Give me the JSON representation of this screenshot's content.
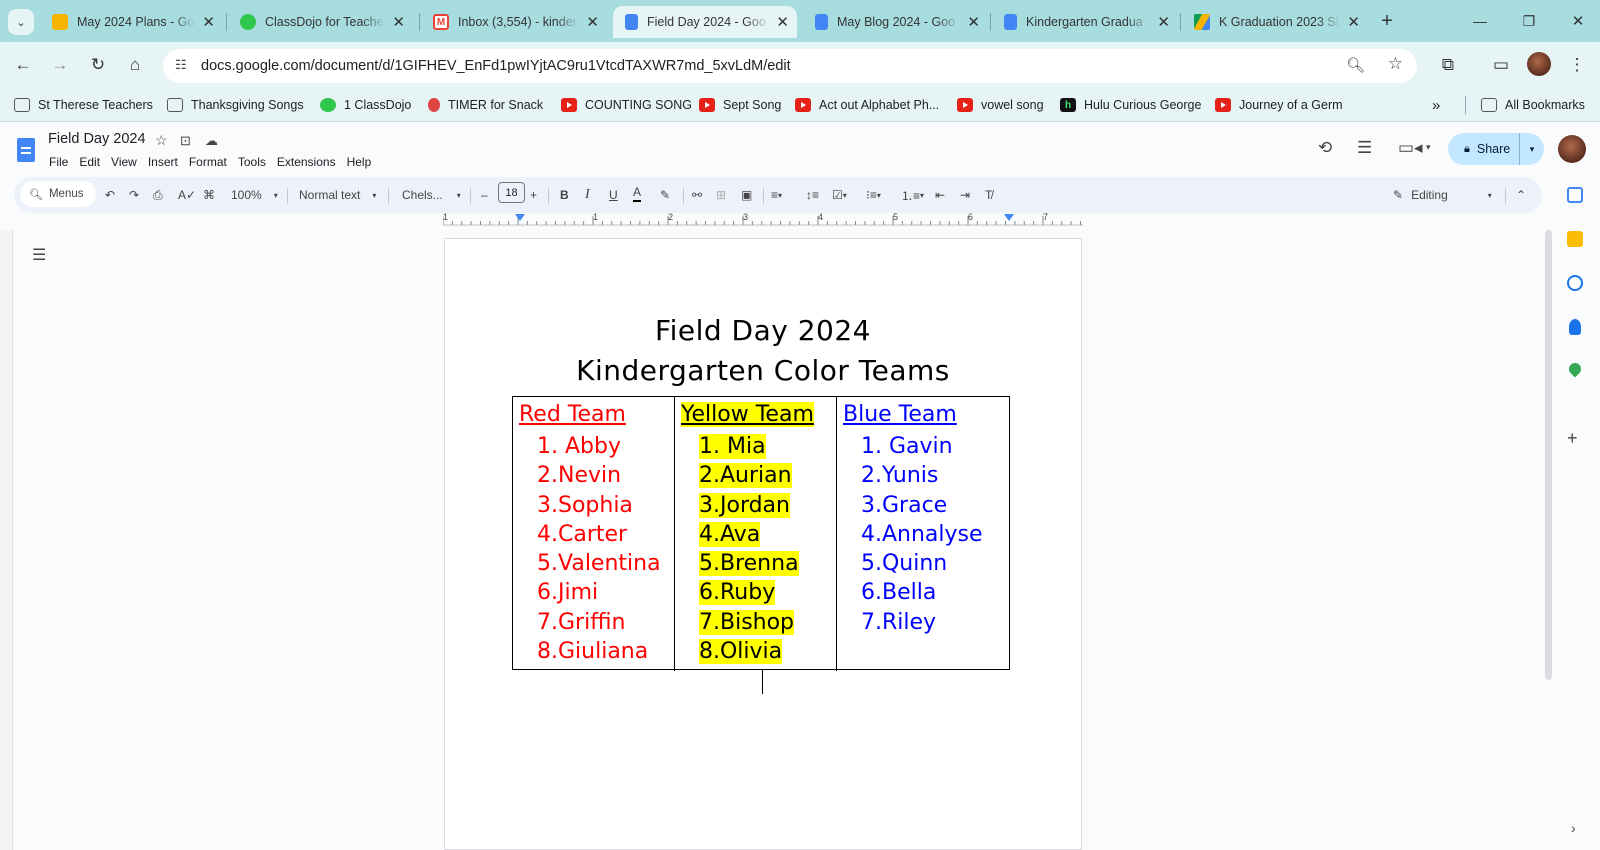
{
  "browser": {
    "tabs": [
      {
        "label": "May 2024 Plans - Go",
        "icon": "slides-icon",
        "color": "#f4b400"
      },
      {
        "label": "ClassDojo for Teache",
        "icon": "classdojo-icon",
        "color": "#2fc84d"
      },
      {
        "label": "Inbox (3,554) - kinder",
        "icon": "gmail-icon",
        "color": "#ea4335"
      },
      {
        "label": "Field Day 2024 - Goo",
        "icon": "docs-icon",
        "color": "#4285f4"
      },
      {
        "label": "May Blog 2024 - Goo",
        "icon": "docs-icon",
        "color": "#4285f4"
      },
      {
        "label": "Kindergarten Gradua",
        "icon": "docs-icon",
        "color": "#4285f4"
      },
      {
        "label": "K Graduation 2023 Sl",
        "icon": "drive-icon",
        "color": "#0f9d58"
      }
    ],
    "url": "docs.google.com/document/d/1GIFHEV_EnFd1pwIYjtAC9ru1VtcdTAXWR7md_5xvLdM/edit",
    "bookmarks": [
      {
        "label": "St Therese Teachers",
        "icon": "folder-icon"
      },
      {
        "label": "Thanksgiving Songs",
        "icon": "folder-icon"
      },
      {
        "label": "1 ClassDojo",
        "icon": "classdojo-icon"
      },
      {
        "label": "TIMER for Snack",
        "icon": "timer-icon"
      },
      {
        "label": "COUNTING SONG",
        "icon": "youtube-icon"
      },
      {
        "label": "Sept Song",
        "icon": "youtube-icon"
      },
      {
        "label": "Act out Alphabet Ph...",
        "icon": "youtube-icon"
      },
      {
        "label": "vowel song",
        "icon": "youtube-icon"
      },
      {
        "label": "Hulu Curious George",
        "icon": "hulu-icon"
      },
      {
        "label": "Journey of a Germ",
        "icon": "youtube-icon"
      }
    ],
    "all_bookmarks": "All Bookmarks"
  },
  "docs": {
    "title": "Field Day 2024",
    "menus": [
      "File",
      "Edit",
      "View",
      "Insert",
      "Format",
      "Tools",
      "Extensions",
      "Help"
    ],
    "share_label": "Share",
    "toolbar": {
      "search_menus": "Menus",
      "zoom": "100%",
      "style": "Normal text",
      "font": "Chels...",
      "font_size": "18",
      "mode": "Editing"
    },
    "ruler_numbers": [
      "1",
      "1",
      "2",
      "3",
      "4",
      "5",
      "6",
      "7"
    ]
  },
  "document": {
    "title_line1": "Field Day 2024",
    "title_line2": "Kindergarten Color Teams",
    "teams": [
      {
        "name": "Red Team",
        "color": "#ff0000",
        "highlight": false,
        "members": [
          "1. Abby",
          "2.Nevin",
          "3.Sophia",
          "4.Carter",
          "5.Valentina",
          "6.Jimi",
          "7.Griffin",
          "8.Giuliana"
        ]
      },
      {
        "name": "Yellow Team",
        "color": "#000000",
        "highlight": true,
        "members": [
          "1. Mia",
          "2.Aurian",
          "3.Jordan",
          "4.Ava",
          "5.Brenna",
          "6.Ruby",
          "7.Bishop",
          "8.Olivia"
        ]
      },
      {
        "name": "Blue Team",
        "color": "#0000ff",
        "highlight": false,
        "members": [
          "1. Gavin",
          "2.Yunis",
          "3.Grace",
          "4.Annalyse",
          "5.Quinn",
          "6.Bella",
          "7.Riley"
        ]
      }
    ]
  }
}
